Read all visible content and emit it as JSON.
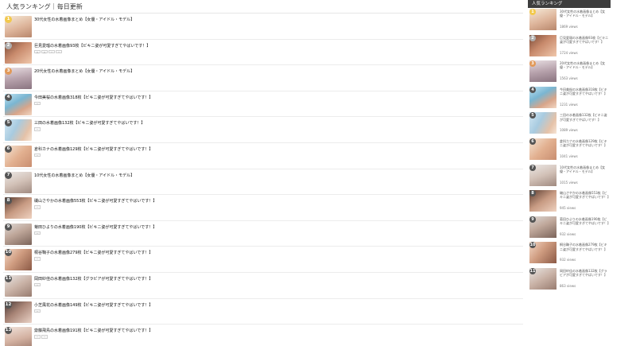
{
  "page": {
    "title": "人気ランキング｜毎日更新"
  },
  "ranking": [
    {
      "rank": "1",
      "title": "30代女性の水着画像まとめ【女優・アイドル・モデル】",
      "tags": [],
      "badge_color": "#f2c94c"
    },
    {
      "rank": "2",
      "title": "巨見愛瑠の水着画像93枚【ビキニ姿が可愛すぎてやばいです！】",
      "tags": [
        "人",
        "人",
        "ー",
        "ー"
      ],
      "badge_color": "#b0b0b0"
    },
    {
      "rank": "3",
      "title": "20代女性の水着画像まとめ【女優・アイドル・モデル】",
      "tags": [],
      "badge_color": "#e29a5a"
    },
    {
      "rank": "4",
      "title": "今田美桜の水着画像318枚【ビキニ姿が可愛すぎてやばいです！】",
      "tags": [
        "ー"
      ],
      "badge_color": "#555555"
    },
    {
      "rank": "5",
      "title": "三田の水着画像132枚【ビキニ姿が可愛すぎてやばいです！】",
      "tags": [
        "ー"
      ],
      "badge_color": "#555555"
    },
    {
      "rank": "6",
      "title": "倉科カナの水着画像129枚【ビキニ姿が可愛すぎてやばいです！】",
      "tags": [
        "ー"
      ],
      "badge_color": "#555555"
    },
    {
      "rank": "7",
      "title": "10代女性の水着画像まとめ【女優・アイドル・モデル】",
      "tags": [],
      "badge_color": "#555555"
    },
    {
      "rank": "8",
      "title": "磯山さやかの水着画像553枚【ビキニ姿が可愛すぎてやばいです！】",
      "tags": [
        "ー"
      ],
      "badge_color": "#555555"
    },
    {
      "rank": "9",
      "title": "菊田ひよりの水着画像190枚【ビキニ姿が可愛すぎてやばいです！】",
      "tags": [
        "ー"
      ],
      "badge_color": "#555555"
    },
    {
      "rank": "10",
      "title": "桐谷鞠子の水着画像279枚【ビキニ姿が可愛すぎてやばいです！】",
      "tags": [
        "ー"
      ],
      "badge_color": "#555555"
    },
    {
      "rank": "11",
      "title": "岡田紗佳の水着画像132枚【グラビアが可愛すぎてやばいです！】",
      "tags": [
        "ー"
      ],
      "badge_color": "#555555"
    },
    {
      "rank": "12",
      "title": "小芝風花の水着画像149枚【ビキニ姿が可愛すぎてやばいです！】",
      "tags": [
        "ー"
      ],
      "badge_color": "#555555"
    },
    {
      "rank": "13",
      "title": "齋藤飛鳥の水着画像191枚【ビキニ姿が可愛すぎてやばいです！】",
      "tags": [
        "ー",
        "ー"
      ],
      "badge_color": "#555555"
    }
  ],
  "sidebar": {
    "header": "人気ランキング",
    "items": [
      {
        "rank": "1",
        "title": "30代女性の水着画像まとめ【女優・アイドル・モデル】",
        "views": "1869 views",
        "badge_color": "#f2c94c"
      },
      {
        "rank": "2",
        "title": "巨見愛瑠の水着画像93枚【ビキニ姿が可愛すぎてやばいです！】",
        "views": "1724 views",
        "badge_color": "#b0b0b0"
      },
      {
        "rank": "3",
        "title": "20代女性の水着画像まとめ【女優・アイドル・モデル】",
        "views": "1563 views",
        "badge_color": "#e29a5a"
      },
      {
        "rank": "4",
        "title": "今田美桜の水着画像318枚【ビキニ姿が可愛すぎてやばいです！】",
        "views": "1231 views",
        "badge_color": "#555555"
      },
      {
        "rank": "5",
        "title": "三田の水着画像132枚【ビキニ姿が可愛すぎてやばいです！】",
        "views": "1089 views",
        "badge_color": "#555555"
      },
      {
        "rank": "6",
        "title": "倉科カナの水着画像129枚【ビキニ姿が可愛すぎてやばいです！】",
        "views": "1041 views",
        "badge_color": "#555555"
      },
      {
        "rank": "7",
        "title": "10代女性の水着画像まとめ【女優・アイドル・モデル】",
        "views": "1015 views",
        "badge_color": "#555555"
      },
      {
        "rank": "8",
        "title": "磯山さやかの水着画像553枚【ビキニ姿が可愛すぎてやばいです！】",
        "views": "945 views",
        "badge_color": "#555555"
      },
      {
        "rank": "9",
        "title": "菊田ひよりの水着画像190枚【ビキニ姿が可愛すぎてやばいです！】",
        "views": "932 views",
        "badge_color": "#555555"
      },
      {
        "rank": "10",
        "title": "桐谷鞠子の水着画像279枚【ビキニ姿が可愛すぎてやばいです！】",
        "views": "932 views",
        "badge_color": "#555555"
      },
      {
        "rank": "11",
        "title": "岡田紗佳の水着画像132枚【グラビアが可愛すぎてやばいです！】",
        "views": "863 views",
        "badge_color": "#555555"
      }
    ]
  }
}
